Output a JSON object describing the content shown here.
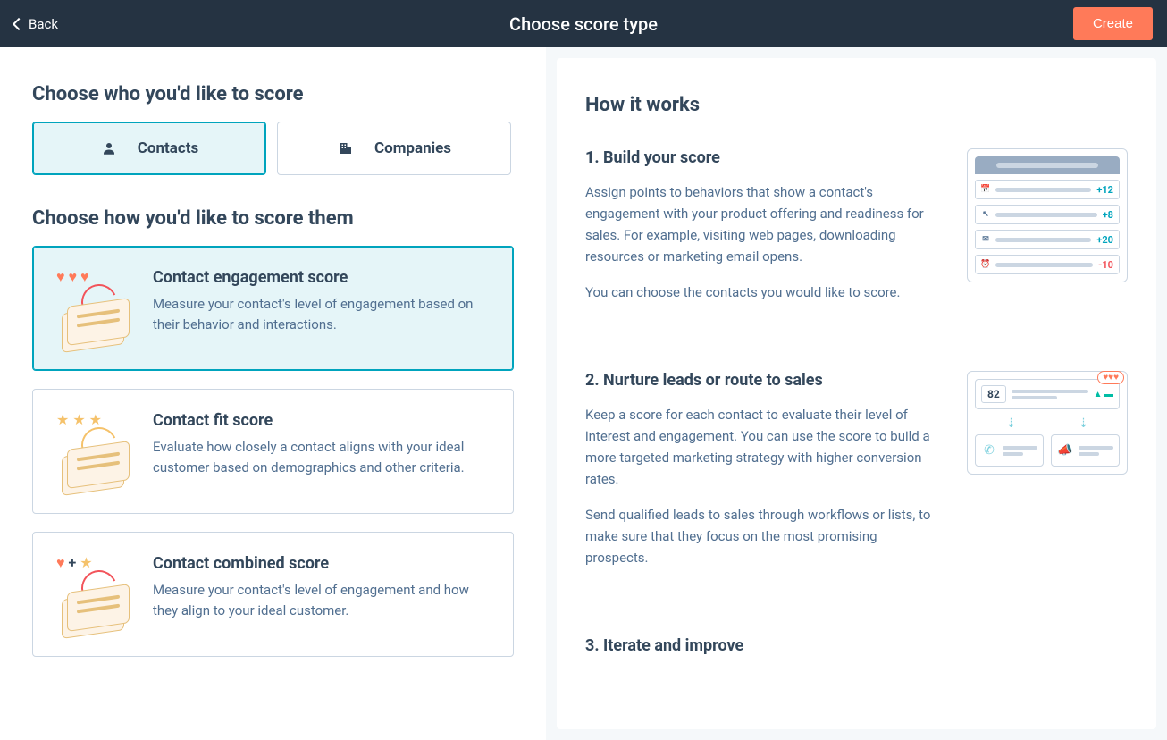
{
  "header": {
    "back_label": "Back",
    "title": "Choose score type",
    "create_label": "Create"
  },
  "left": {
    "who_heading": "Choose who you'd like to score",
    "tabs": [
      {
        "label": "Contacts",
        "selected": true
      },
      {
        "label": "Companies",
        "selected": false
      }
    ],
    "how_heading": "Choose how you'd like to score them",
    "options": [
      {
        "title": "Contact engagement score",
        "desc": "Measure your contact's level of engagement based on their behavior and interactions.",
        "selected": true,
        "icon_style": "hearts"
      },
      {
        "title": "Contact fit score",
        "desc": "Evaluate how closely a contact aligns with your ideal customer based on demographics and other criteria.",
        "selected": false,
        "icon_style": "stars"
      },
      {
        "title": "Contact combined score",
        "desc": "Measure your contact's level of engagement and how they align to your ideal customer.",
        "selected": false,
        "icon_style": "mixed"
      }
    ]
  },
  "right": {
    "heading": "How it works",
    "steps": [
      {
        "title": "1. Build your score",
        "paragraphs": [
          "Assign points to behaviors that show a contact's engagement with your product offering and readiness for sales. For example, visiting web pages, downloading resources or marketing email opens.",
          "You can choose the contacts you would like to score."
        ],
        "score_rows": [
          {
            "value": "+12",
            "sign": "pos"
          },
          {
            "value": "+8",
            "sign": "pos"
          },
          {
            "value": "+20",
            "sign": "pos"
          },
          {
            "value": "-10",
            "sign": "neg"
          }
        ]
      },
      {
        "title": "2. Nurture leads or route to sales",
        "paragraphs": [
          "Keep a score for each contact to evaluate their level of interest and engagement. You can use the score to build a more targeted marketing strategy with higher conversion rates.",
          "Send qualified leads to sales through workflows or lists, to make sure that they focus on the most promising prospects."
        ],
        "score_value": "82",
        "hearts": "♥♥♥"
      },
      {
        "title": "3. Iterate and improve",
        "paragraphs": []
      }
    ]
  }
}
